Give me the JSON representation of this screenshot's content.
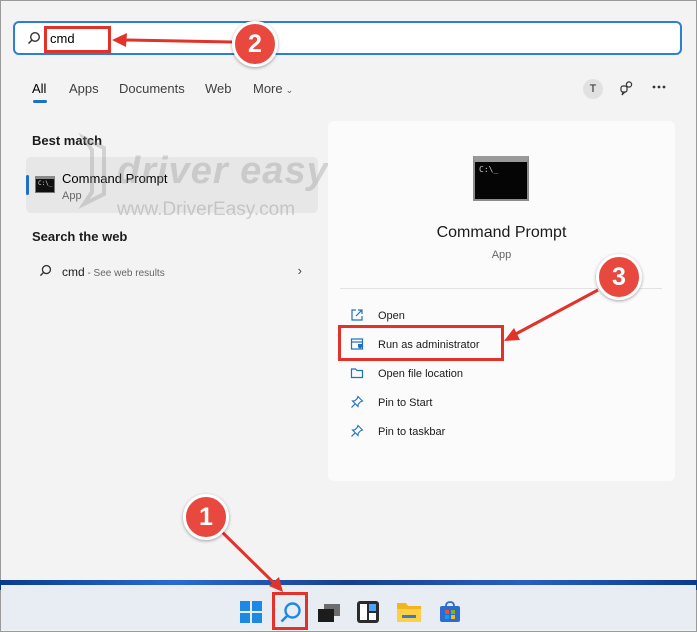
{
  "search": {
    "query": "cmd"
  },
  "tabs": [
    "All",
    "Apps",
    "Documents",
    "Web",
    "More"
  ],
  "header": {
    "avatar_initial": "T"
  },
  "left": {
    "best_match_heading": "Best match",
    "best_match": {
      "title": "Command Prompt",
      "subtitle": "App"
    },
    "search_web_heading": "Search the web",
    "web_result": {
      "query": "cmd",
      "hint": " - See web results"
    }
  },
  "watermark": {
    "text": "driver easy",
    "url": "www.DriverEasy.com"
  },
  "preview": {
    "title": "Command Prompt",
    "subtitle": "App",
    "actions": [
      "Open",
      "Run as administrator",
      "Open file location",
      "Pin to Start",
      "Pin to taskbar"
    ]
  },
  "callouts": [
    "1",
    "2",
    "3"
  ],
  "colors": {
    "accent": "#1f6fc5",
    "callout_red": "#e2322a"
  },
  "icons": [
    "search-icon",
    "chat-icon",
    "more-icon",
    "chevron-down-icon",
    "chevron-right-icon",
    "open-icon",
    "shield-icon",
    "folder-icon",
    "pin-icon",
    "windows-start-icon",
    "task-view-icon",
    "widgets-icon",
    "file-explorer-icon",
    "store-icon"
  ]
}
